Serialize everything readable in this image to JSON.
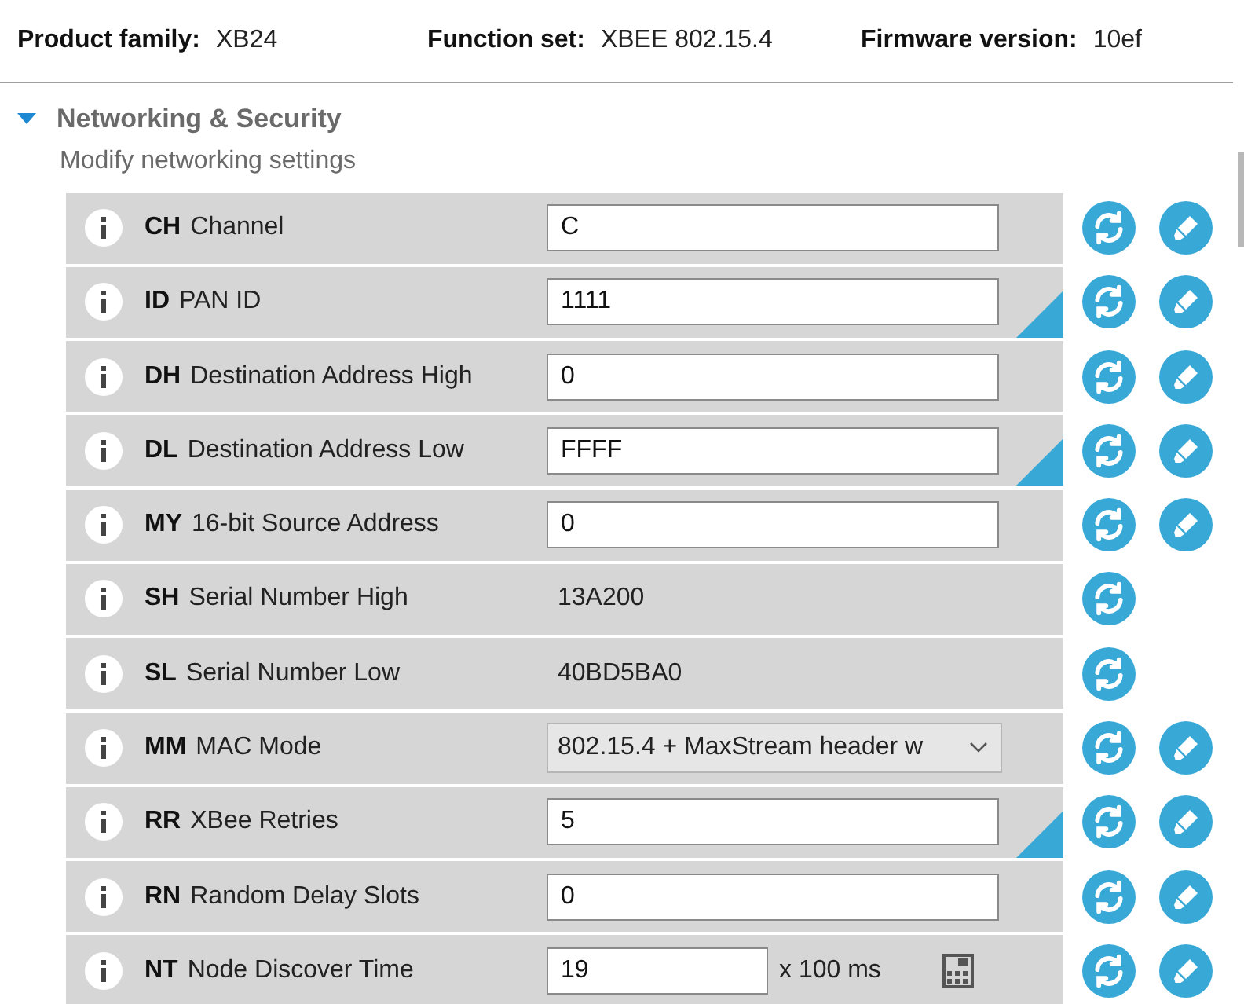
{
  "header": [
    {
      "label": "Product family:",
      "value": "XB24"
    },
    {
      "label": "Function set:",
      "value": "XBEE 802.15.4"
    },
    {
      "label": "Firmware version:",
      "value": "10ef"
    }
  ],
  "section": {
    "title": "Networking & Security",
    "subtitle": "Modify networking settings",
    "expanded": true
  },
  "settings": [
    {
      "kind": "text",
      "code": "CH",
      "name": "Channel",
      "value": "C",
      "changed": false
    },
    {
      "kind": "text",
      "code": "ID",
      "name": "PAN ID",
      "value": "1111",
      "changed": true
    },
    {
      "kind": "text",
      "code": "DH",
      "name": "Destination Address High",
      "value": "0",
      "changed": false
    },
    {
      "kind": "text",
      "code": "DL",
      "name": "Destination Address Low",
      "value": "FFFF",
      "changed": true
    },
    {
      "kind": "text",
      "code": "MY",
      "name": "16-bit Source Address",
      "value": "0",
      "changed": false
    },
    {
      "kind": "readonly",
      "code": "SH",
      "name": "Serial Number High",
      "value": "13A200",
      "changed": false
    },
    {
      "kind": "readonly",
      "code": "SL",
      "name": "Serial Number Low",
      "value": "40BD5BA0",
      "changed": false
    },
    {
      "kind": "select",
      "code": "MM",
      "name": "MAC Mode",
      "value": "802.15.4 + MaxStream header w",
      "changed": false
    },
    {
      "kind": "text",
      "code": "RR",
      "name": "XBee Retries",
      "value": "5",
      "changed": true
    },
    {
      "kind": "text",
      "code": "RN",
      "name": "Random Delay Slots",
      "value": "0",
      "changed": false
    },
    {
      "kind": "unit",
      "code": "NT",
      "name": "Node Discover Time",
      "value": "19",
      "unit": "x 100 ms",
      "changed": false
    }
  ]
}
